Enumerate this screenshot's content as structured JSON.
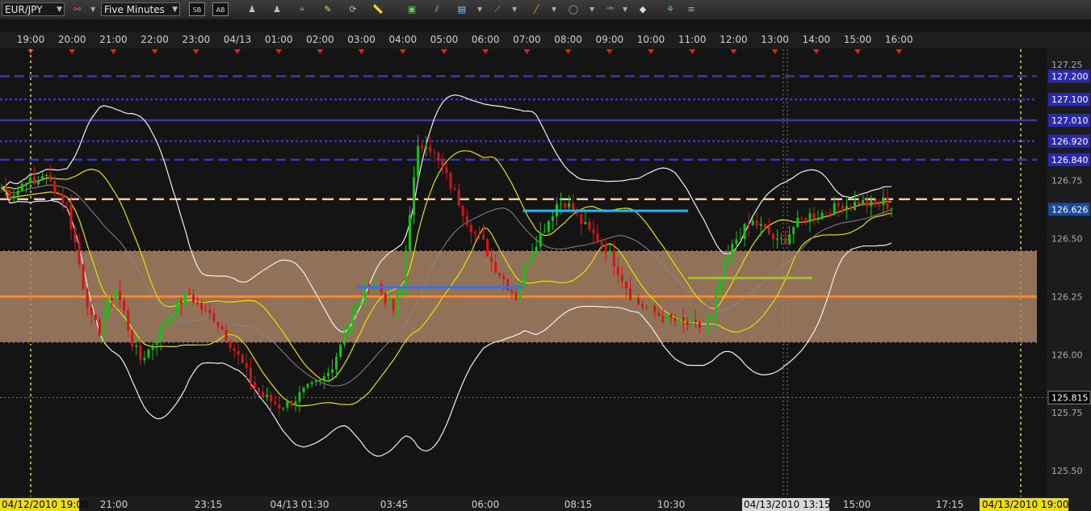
{
  "toolbar": {
    "symbol": "EUR/JPY",
    "timeframe": "Five Minutes",
    "buttons": [
      {
        "name": "chart-type-icon"
      },
      {
        "name": "cursor-icon"
      },
      {
        "name": "draw-line-icon"
      },
      {
        "name": "fibonacci-icon"
      },
      {
        "name": "comment-icon"
      },
      {
        "name": "refresh-icon"
      },
      {
        "name": "ruler-icon"
      },
      {
        "name": "picture-icon"
      },
      {
        "name": "channel-icon"
      },
      {
        "name": "indicator-icon"
      },
      {
        "name": "pencil-icon"
      },
      {
        "name": "brush-icon"
      },
      {
        "name": "ellipse-icon"
      },
      {
        "name": "text-icon"
      },
      {
        "name": "eraser-icon"
      },
      {
        "name": "tree-icon"
      }
    ],
    "box_label_1": "SB",
    "box_label_2": "AB"
  },
  "chart_data": {
    "type": "candlestick",
    "symbol": "EUR/JPY",
    "timeframe": "Five Minutes",
    "top_axis_labels": [
      "19:00",
      "20:00",
      "21:00",
      "22:00",
      "23:00",
      "04/13",
      "01:00",
      "02:00",
      "03:00",
      "04:00",
      "05:00",
      "06:00",
      "07:00",
      "08:00",
      "09:00",
      "10:00",
      "11:00",
      "12:00",
      "13:00",
      "14:00",
      "15:00",
      "16:00"
    ],
    "bottom_axis_labels": [
      "21:00",
      "23:15",
      "04/13 01:30",
      "03:45",
      "06:00",
      "08:15",
      "10:30",
      "15:00",
      "17:15"
    ],
    "bottom_highlight_left": "04/12/2010 19:00",
    "bottom_highlight_right": "04/13/2010 19:00",
    "crosshair_date": "04/13/2010 13:15",
    "y_tick_labels": [
      "127.25",
      "126.75",
      "126.50",
      "126.25",
      "126.00",
      "125.75",
      "125.50"
    ],
    "ylim": [
      125.42,
      127.3
    ],
    "horizontal_levels": [
      {
        "label": "127.200",
        "value": 127.2,
        "style": "dashed",
        "color": "#3a3aa8"
      },
      {
        "label": "127.100",
        "value": 127.1,
        "style": "dotted",
        "color": "#3a3aa8"
      },
      {
        "label": "127.010",
        "value": 127.01,
        "style": "solid",
        "color": "#3a3aa8"
      },
      {
        "label": "126.920",
        "value": 126.92,
        "style": "dotted",
        "color": "#3a3aa8"
      },
      {
        "label": "126.840",
        "value": 126.84,
        "style": "dashed",
        "color": "#3a3aa8"
      },
      {
        "label": "",
        "value": 126.67,
        "style": "dashed",
        "color": "#f4c9a0"
      },
      {
        "label": "",
        "value": 126.25,
        "style": "solid",
        "color": "#f08a40"
      }
    ],
    "current_price_label": "126.626",
    "current_price": 126.626,
    "crosshair_price_label": "125.815",
    "crosshair_price": 125.815,
    "zone": {
      "low": 126.05,
      "high": 126.45,
      "color": "#b08a6a"
    },
    "segments": [
      {
        "color": "#3a6ee8",
        "value": 126.29,
        "from": "03:00",
        "to": "07:00"
      },
      {
        "color": "#27b4e8",
        "value": 126.62,
        "from": "07:00",
        "to": "11:00"
      },
      {
        "color": "#9ac81e",
        "value": 126.33,
        "from": "11:00",
        "to": "14:00"
      }
    ],
    "series": [
      {
        "values": [
          126.72,
          126.69,
          126.71,
          126.76,
          126.73,
          126.78,
          126.74,
          126.69,
          126.64,
          126.48,
          126.3,
          126.15,
          126.1,
          126.22,
          126.28,
          126.18,
          126.05,
          125.98,
          126.02,
          126.08,
          126.14,
          126.19,
          126.23,
          126.26,
          126.22,
          126.18,
          126.16,
          126.11,
          126.05,
          125.99,
          125.92,
          125.86,
          125.82,
          125.8,
          125.78,
          125.79,
          125.81,
          125.84,
          125.86,
          125.88,
          125.92,
          126.0,
          126.1,
          126.18,
          126.24,
          126.32,
          126.3,
          126.24,
          126.19,
          126.28,
          126.62,
          126.88,
          126.92,
          126.86,
          126.8,
          126.73,
          126.66,
          126.58,
          126.52,
          126.48,
          126.4,
          126.35,
          126.3,
          126.25,
          126.38,
          126.46,
          126.52,
          126.58,
          126.65,
          126.66,
          126.62,
          126.57,
          126.53,
          126.5,
          126.46,
          126.4,
          126.33,
          126.26,
          126.22,
          126.2,
          126.18,
          126.16,
          126.15,
          126.14,
          126.13,
          126.12,
          126.12,
          126.15,
          126.32,
          126.42,
          126.5,
          126.54,
          126.57,
          126.55,
          126.52,
          126.48,
          126.5,
          126.55,
          126.58,
          126.6,
          126.6,
          126.62,
          126.63,
          126.65,
          126.64,
          126.66,
          126.65,
          126.64,
          126.66,
          126.63
        ]
      }
    ]
  }
}
